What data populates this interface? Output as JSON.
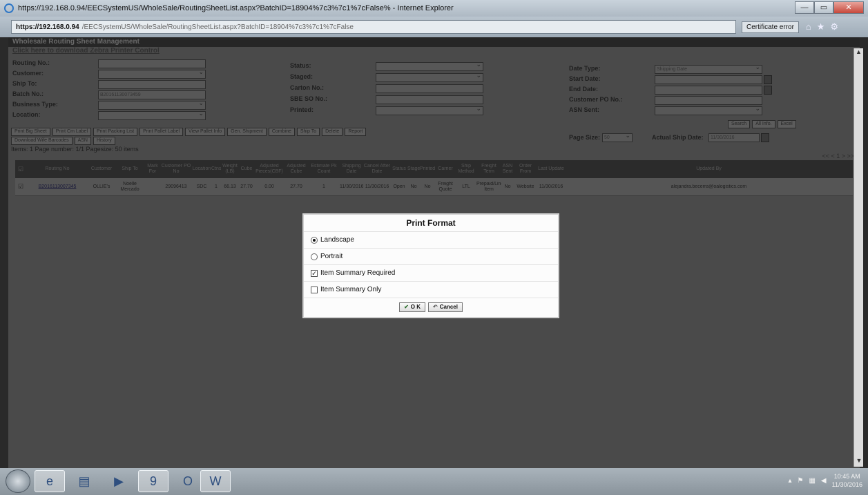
{
  "window": {
    "title": "https://192.168.0.94/EECSystemUS/WholeSale/RoutingSheetList.aspx?BatchID=18904%7c3%7c1%7cFalse% - Internet Explorer",
    "address_host": "https://192.168.0.94",
    "address_path": "/EECSystemUS/WholeSale/RoutingSheetList.aspx?BatchID=18904%7c3%7c1%7cFalse",
    "cert_error": "Certificate error",
    "min": "—",
    "max": "▭",
    "close": "✕"
  },
  "app": {
    "header": "Wholesale Routing Sheet Management",
    "download_link": "Click here to download Zebra Printer Control",
    "filters": {
      "routing_no": "Routing No.:",
      "customer": "Customer:",
      "ship_to": "Ship To:",
      "batch_no": "Batch No.:",
      "batch_no_value": "B20161130073459",
      "business_type": "Business Type:",
      "location": "Location:",
      "status": "Status:",
      "staged": "Staged:",
      "carton_no": "Carton No.:",
      "sbe_so_no": "SBE SO No.:",
      "printed": "Printed:",
      "date_type": "Date Type:",
      "date_type_value": "Shipping Date",
      "start_date": "Start Date:",
      "end_date": "End Date:",
      "customer_po": "Customer PO No.:",
      "asn_sent": "ASN Sent:"
    },
    "buttons_row1": [
      "Print Big Sheet",
      "Print Cm Label",
      "Print Packing List",
      "Print Pallet Label",
      "View Pallet Info",
      "Gen. Shipment",
      "Combine",
      "Ship To",
      "Delete",
      "Report"
    ],
    "buttons_row2": [
      "Download Wife Barcodes",
      "ASN",
      "History"
    ],
    "search_buttons": [
      "Search",
      "All Info.",
      "Excel"
    ],
    "page_size_label": "Page Size:",
    "page_size_value": "50",
    "actual_ship_label": "Actual Ship Date:",
    "actual_ship_value": "11/30/2016",
    "items_info": "Items: 1   Page number: 1/1   Pagesize: 50 items",
    "pager": "<< < 1 > >>"
  },
  "table": {
    "headers": [
      "Routing No",
      "Customer",
      "Ship To",
      "Mark For",
      "Customer PO No",
      "Location",
      "Ctns",
      "Weight (LB)",
      "Cube",
      "Adjusted Pieces(CBF)",
      "Adjusted Cube",
      "Estimate Pk Count",
      "Shipping Date",
      "Cancel After Date",
      "Status",
      "Staged",
      "Printed",
      "Carrier",
      "Ship Method",
      "Freight Term",
      "ASN Sent",
      "Order From",
      "Last Update",
      "Updated By"
    ],
    "rows": [
      [
        "B2016113007345",
        "OLLIE's",
        "Noelle Mercado",
        "",
        "29096413",
        "SDC",
        "1",
        "66.13",
        "27.70",
        "0.00",
        "27.70",
        "1",
        "11/30/2016",
        "11/30/2016",
        "Open",
        "No",
        "No",
        "Freight Quote",
        "LTL",
        "Prepaid/Line Item",
        "No",
        "Website",
        "11/30/2016",
        "alejandra.becerra@oalogistics.com"
      ]
    ]
  },
  "modal": {
    "title": "Print Format",
    "landscape": "Landscape",
    "portrait": "Portrait",
    "item_summary_required": "Item Summary Required",
    "item_summary_only": "Item Summary Only",
    "ok": "O K",
    "cancel": "Cancel"
  },
  "taskbar": {
    "time": "10:45 AM",
    "date": "11/30/2016"
  }
}
